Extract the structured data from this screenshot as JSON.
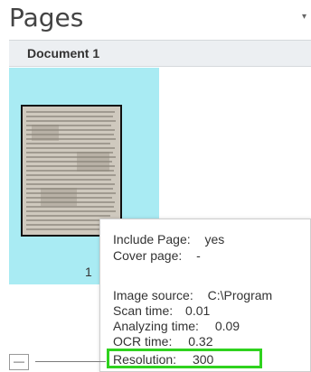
{
  "pane": {
    "title": "Pages",
    "menu_icon": "chevron-down-icon"
  },
  "document": {
    "label": "Document 1"
  },
  "pages": [
    {
      "number": "1",
      "selected": true
    }
  ],
  "tooltip": {
    "include_page_label": "Include Page:",
    "include_page_value": "yes",
    "cover_page_label": "Cover page:",
    "cover_page_value": "-",
    "image_source_label": "Image source:",
    "image_source_value": "C:\\Program",
    "scan_time_label": "Scan time:",
    "scan_time_value": "0.01",
    "analyzing_time_label": "Analyzing time:",
    "analyzing_time_value": "0.09",
    "ocr_time_label": "OCR time:",
    "ocr_time_value": "0.32",
    "resolution_label": "Resolution:",
    "resolution_value": "300"
  },
  "toolbar": {
    "zoom_out_icon": "minus-icon"
  },
  "colors": {
    "selected_tile": "#a9ebf3",
    "header_bg": "#eceff2",
    "highlight_box": "#2fd21e"
  }
}
